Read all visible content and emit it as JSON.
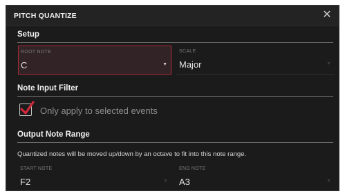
{
  "dialog": {
    "title": "PITCH QUANTIZE",
    "close_icon": "close-icon"
  },
  "setup": {
    "heading": "Setup",
    "root_note": {
      "label": "ROOT NOTE",
      "value": "C"
    },
    "scale": {
      "label": "SCALE",
      "value": "Major"
    }
  },
  "note_input_filter": {
    "heading": "Note Input Filter",
    "checkbox": {
      "label": "Only apply to selected events",
      "checked": true
    }
  },
  "output_note_range": {
    "heading": "Output Note Range",
    "description": "Quantized notes will be moved up/down by an octave to fit into this note range.",
    "start_note": {
      "label": "START NOTE",
      "value": "F2"
    },
    "end_note": {
      "label": "END NOTE",
      "value": "A3"
    }
  },
  "colors": {
    "background": "#1b1b1b",
    "accent": "#d4283c",
    "selected_field": "#312326"
  }
}
